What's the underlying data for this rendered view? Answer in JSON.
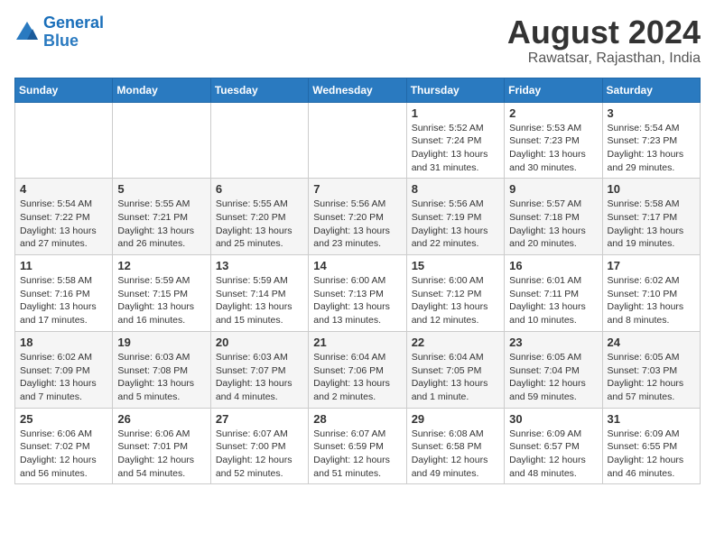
{
  "logo": {
    "line1": "General",
    "line2": "Blue"
  },
  "title": {
    "month_year": "August 2024",
    "location": "Rawatsar, Rajasthan, India"
  },
  "days_of_week": [
    "Sunday",
    "Monday",
    "Tuesday",
    "Wednesday",
    "Thursday",
    "Friday",
    "Saturday"
  ],
  "weeks": [
    [
      {
        "day": "",
        "sunrise": "",
        "sunset": "",
        "daylight": ""
      },
      {
        "day": "",
        "sunrise": "",
        "sunset": "",
        "daylight": ""
      },
      {
        "day": "",
        "sunrise": "",
        "sunset": "",
        "daylight": ""
      },
      {
        "day": "",
        "sunrise": "",
        "sunset": "",
        "daylight": ""
      },
      {
        "day": "1",
        "sunrise": "Sunrise: 5:52 AM",
        "sunset": "Sunset: 7:24 PM",
        "daylight": "Daylight: 13 hours and 31 minutes."
      },
      {
        "day": "2",
        "sunrise": "Sunrise: 5:53 AM",
        "sunset": "Sunset: 7:23 PM",
        "daylight": "Daylight: 13 hours and 30 minutes."
      },
      {
        "day": "3",
        "sunrise": "Sunrise: 5:54 AM",
        "sunset": "Sunset: 7:23 PM",
        "daylight": "Daylight: 13 hours and 29 minutes."
      }
    ],
    [
      {
        "day": "4",
        "sunrise": "Sunrise: 5:54 AM",
        "sunset": "Sunset: 7:22 PM",
        "daylight": "Daylight: 13 hours and 27 minutes."
      },
      {
        "day": "5",
        "sunrise": "Sunrise: 5:55 AM",
        "sunset": "Sunset: 7:21 PM",
        "daylight": "Daylight: 13 hours and 26 minutes."
      },
      {
        "day": "6",
        "sunrise": "Sunrise: 5:55 AM",
        "sunset": "Sunset: 7:20 PM",
        "daylight": "Daylight: 13 hours and 25 minutes."
      },
      {
        "day": "7",
        "sunrise": "Sunrise: 5:56 AM",
        "sunset": "Sunset: 7:20 PM",
        "daylight": "Daylight: 13 hours and 23 minutes."
      },
      {
        "day": "8",
        "sunrise": "Sunrise: 5:56 AM",
        "sunset": "Sunset: 7:19 PM",
        "daylight": "Daylight: 13 hours and 22 minutes."
      },
      {
        "day": "9",
        "sunrise": "Sunrise: 5:57 AM",
        "sunset": "Sunset: 7:18 PM",
        "daylight": "Daylight: 13 hours and 20 minutes."
      },
      {
        "day": "10",
        "sunrise": "Sunrise: 5:58 AM",
        "sunset": "Sunset: 7:17 PM",
        "daylight": "Daylight: 13 hours and 19 minutes."
      }
    ],
    [
      {
        "day": "11",
        "sunrise": "Sunrise: 5:58 AM",
        "sunset": "Sunset: 7:16 PM",
        "daylight": "Daylight: 13 hours and 17 minutes."
      },
      {
        "day": "12",
        "sunrise": "Sunrise: 5:59 AM",
        "sunset": "Sunset: 7:15 PM",
        "daylight": "Daylight: 13 hours and 16 minutes."
      },
      {
        "day": "13",
        "sunrise": "Sunrise: 5:59 AM",
        "sunset": "Sunset: 7:14 PM",
        "daylight": "Daylight: 13 hours and 15 minutes."
      },
      {
        "day": "14",
        "sunrise": "Sunrise: 6:00 AM",
        "sunset": "Sunset: 7:13 PM",
        "daylight": "Daylight: 13 hours and 13 minutes."
      },
      {
        "day": "15",
        "sunrise": "Sunrise: 6:00 AM",
        "sunset": "Sunset: 7:12 PM",
        "daylight": "Daylight: 13 hours and 12 minutes."
      },
      {
        "day": "16",
        "sunrise": "Sunrise: 6:01 AM",
        "sunset": "Sunset: 7:11 PM",
        "daylight": "Daylight: 13 hours and 10 minutes."
      },
      {
        "day": "17",
        "sunrise": "Sunrise: 6:02 AM",
        "sunset": "Sunset: 7:10 PM",
        "daylight": "Daylight: 13 hours and 8 minutes."
      }
    ],
    [
      {
        "day": "18",
        "sunrise": "Sunrise: 6:02 AM",
        "sunset": "Sunset: 7:09 PM",
        "daylight": "Daylight: 13 hours and 7 minutes."
      },
      {
        "day": "19",
        "sunrise": "Sunrise: 6:03 AM",
        "sunset": "Sunset: 7:08 PM",
        "daylight": "Daylight: 13 hours and 5 minutes."
      },
      {
        "day": "20",
        "sunrise": "Sunrise: 6:03 AM",
        "sunset": "Sunset: 7:07 PM",
        "daylight": "Daylight: 13 hours and 4 minutes."
      },
      {
        "day": "21",
        "sunrise": "Sunrise: 6:04 AM",
        "sunset": "Sunset: 7:06 PM",
        "daylight": "Daylight: 13 hours and 2 minutes."
      },
      {
        "day": "22",
        "sunrise": "Sunrise: 6:04 AM",
        "sunset": "Sunset: 7:05 PM",
        "daylight": "Daylight: 13 hours and 1 minute."
      },
      {
        "day": "23",
        "sunrise": "Sunrise: 6:05 AM",
        "sunset": "Sunset: 7:04 PM",
        "daylight": "Daylight: 12 hours and 59 minutes."
      },
      {
        "day": "24",
        "sunrise": "Sunrise: 6:05 AM",
        "sunset": "Sunset: 7:03 PM",
        "daylight": "Daylight: 12 hours and 57 minutes."
      }
    ],
    [
      {
        "day": "25",
        "sunrise": "Sunrise: 6:06 AM",
        "sunset": "Sunset: 7:02 PM",
        "daylight": "Daylight: 12 hours and 56 minutes."
      },
      {
        "day": "26",
        "sunrise": "Sunrise: 6:06 AM",
        "sunset": "Sunset: 7:01 PM",
        "daylight": "Daylight: 12 hours and 54 minutes."
      },
      {
        "day": "27",
        "sunrise": "Sunrise: 6:07 AM",
        "sunset": "Sunset: 7:00 PM",
        "daylight": "Daylight: 12 hours and 52 minutes."
      },
      {
        "day": "28",
        "sunrise": "Sunrise: 6:07 AM",
        "sunset": "Sunset: 6:59 PM",
        "daylight": "Daylight: 12 hours and 51 minutes."
      },
      {
        "day": "29",
        "sunrise": "Sunrise: 6:08 AM",
        "sunset": "Sunset: 6:58 PM",
        "daylight": "Daylight: 12 hours and 49 minutes."
      },
      {
        "day": "30",
        "sunrise": "Sunrise: 6:09 AM",
        "sunset": "Sunset: 6:57 PM",
        "daylight": "Daylight: 12 hours and 48 minutes."
      },
      {
        "day": "31",
        "sunrise": "Sunrise: 6:09 AM",
        "sunset": "Sunset: 6:55 PM",
        "daylight": "Daylight: 12 hours and 46 minutes."
      }
    ]
  ]
}
